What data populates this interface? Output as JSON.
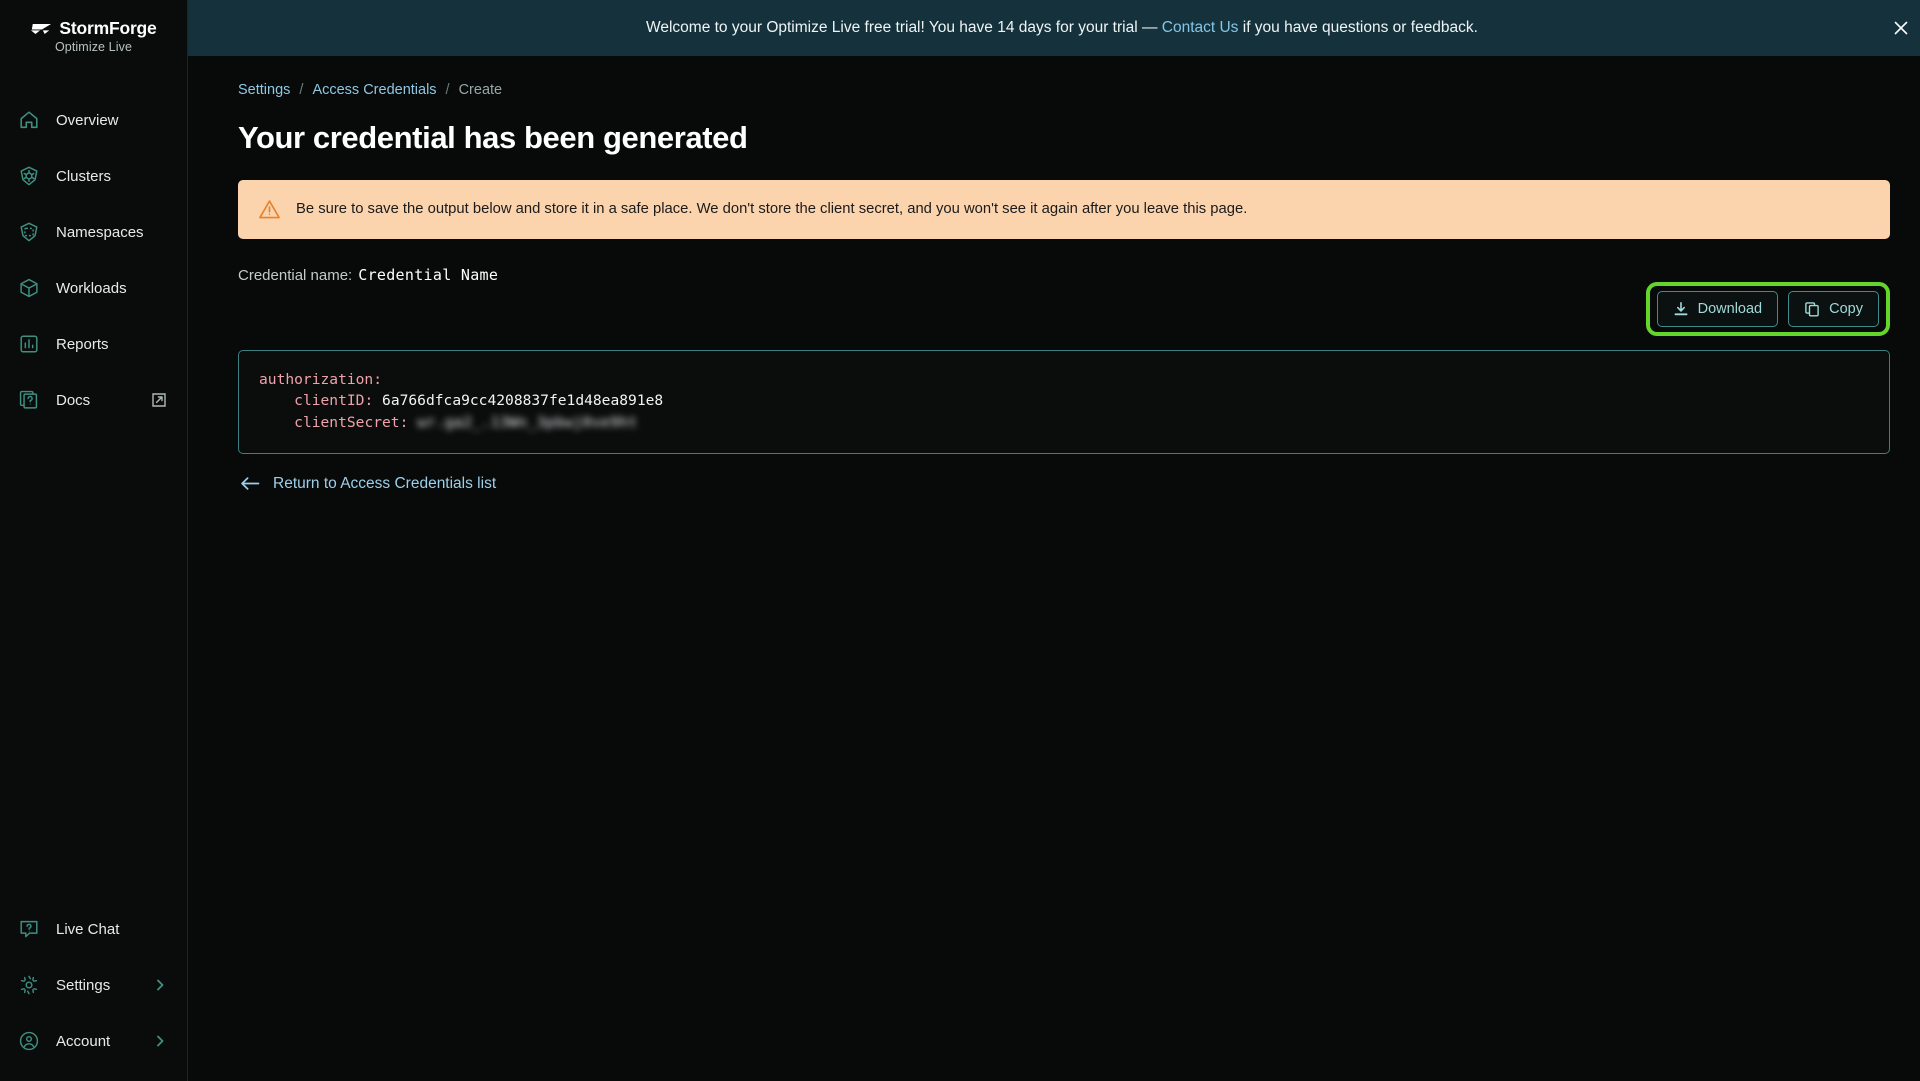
{
  "brand": {
    "name": "StormForge",
    "subtitle": "Optimize Live"
  },
  "sidebar": {
    "items": [
      {
        "label": "Overview",
        "icon": "home-icon"
      },
      {
        "label": "Clusters",
        "icon": "kubernetes-icon"
      },
      {
        "label": "Namespaces",
        "icon": "namespace-icon"
      },
      {
        "label": "Workloads",
        "icon": "cube-icon"
      },
      {
        "label": "Reports",
        "icon": "bar-chart-icon"
      },
      {
        "label": "Docs",
        "icon": "docs-question-icon",
        "trailing": "external-link-icon"
      }
    ],
    "bottom_items": [
      {
        "label": "Live Chat",
        "icon": "chat-question-icon"
      },
      {
        "label": "Settings",
        "icon": "gear-icon",
        "trailing": "chevron-right-icon"
      },
      {
        "label": "Account",
        "icon": "user-circle-icon",
        "trailing": "chevron-right-icon"
      }
    ]
  },
  "banner": {
    "text_before": "Welcome to your Optimize Live free trial! You have 14 days for your trial — ",
    "link_label": "Contact Us",
    "text_after": " if you have questions or feedback.",
    "close_label": "close-banner",
    "background": "#15323c",
    "link_color": "#84c5e8"
  },
  "breadcrumb": {
    "items": [
      {
        "label": "Settings",
        "is_link": true
      },
      {
        "label": "Access Credentials",
        "is_link": true
      },
      {
        "label": "Create",
        "is_link": false
      }
    ],
    "separator": "/"
  },
  "page": {
    "title": "Your credential has been generated"
  },
  "alert": {
    "icon": "warning-triangle-icon",
    "message": "Be sure to save the output below and store it in a safe place. We don't store the client secret, and you won't see it again after you leave this page.",
    "background": "#fbd3ad",
    "icon_color": "#e8832a"
  },
  "credential": {
    "name_label": "Credential name:",
    "name_value": "Credential Name"
  },
  "toolbar": {
    "download_label": "Download",
    "copy_label": "Copy",
    "highlight_color": "#63d52b",
    "button_border_color": "#3f8c8c"
  },
  "code": {
    "line1_key": "authorization:",
    "line2_key": "clientID:",
    "line2_value": "6a766dfca9cc4208837fe1d48ea891e8",
    "line3_key": "clientSecret:",
    "line3_value": "wr.ga2_.13Wn_3pbwj0ve9ht",
    "key_color": "#efa2ab",
    "border_color": "#3d7e7e"
  },
  "return_link": {
    "label": "Return to Access Credentials list",
    "icon": "arrow-left-icon"
  }
}
